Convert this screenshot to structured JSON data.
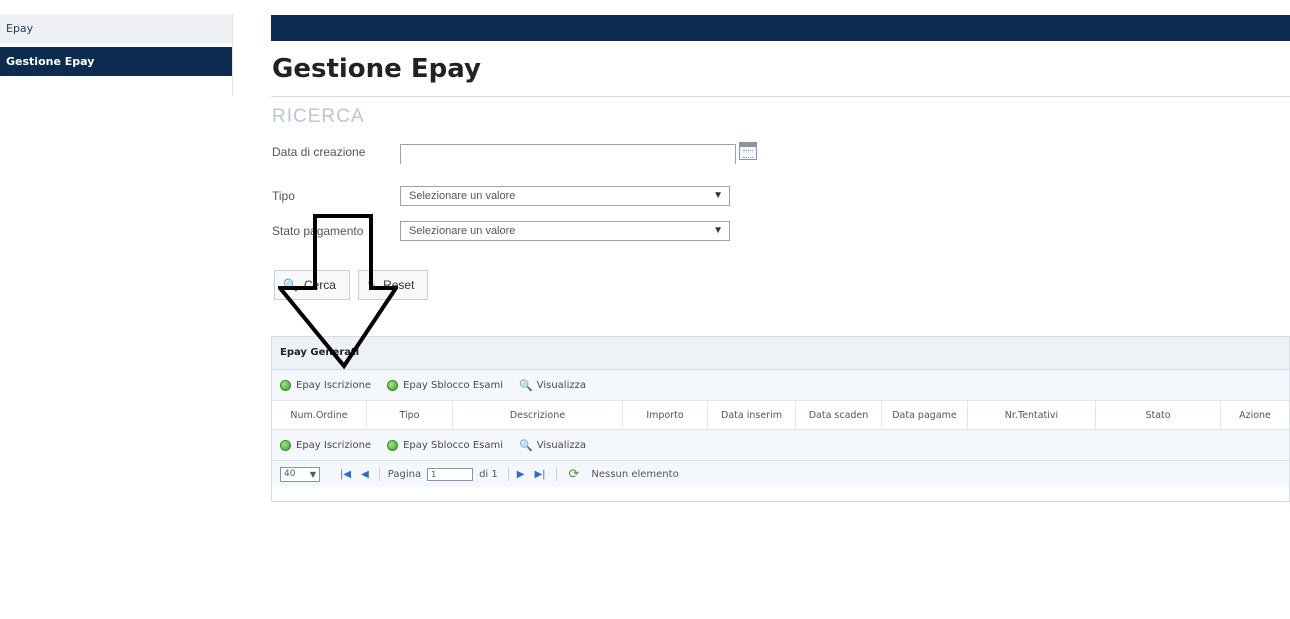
{
  "sidebar": {
    "items": [
      {
        "label": "Epay",
        "active": false
      },
      {
        "label": "Gestione Epay",
        "active": true
      }
    ]
  },
  "page": {
    "title": "Gestione Epay",
    "section_title": "RICERCA"
  },
  "form": {
    "data_creazione_label": "Data di creazione",
    "data_creazione_value": "",
    "tipo_label": "Tipo",
    "tipo_value": "Selezionare un valore",
    "stato_label": "Stato pagamento",
    "stato_value": "Selezionare un valore",
    "cerca_label": "Cerca",
    "reset_label": "Reset"
  },
  "grid": {
    "title": "Epay Generati",
    "toolbar": {
      "epay_iscrizione": "Epay Iscrizione",
      "epay_sblocco": "Epay Sblocco Esami",
      "visualizza": "Visualizza"
    },
    "columns": [
      "Num.Ordine",
      "Tipo",
      "Descrizione",
      "Importo",
      "Data inserim",
      "Data scaden",
      "Data pagame",
      "Nr.Tentativi",
      "Stato",
      "Azione"
    ],
    "pager": {
      "page_size": "40",
      "page_label": "Pagina",
      "page_value": "1",
      "of_label": "di 1",
      "status": "Nessun elemento"
    }
  },
  "colors": {
    "navy": "#0d2b4e",
    "section_title": "#b9c6d6",
    "green_icon": "#3d9a2a"
  }
}
